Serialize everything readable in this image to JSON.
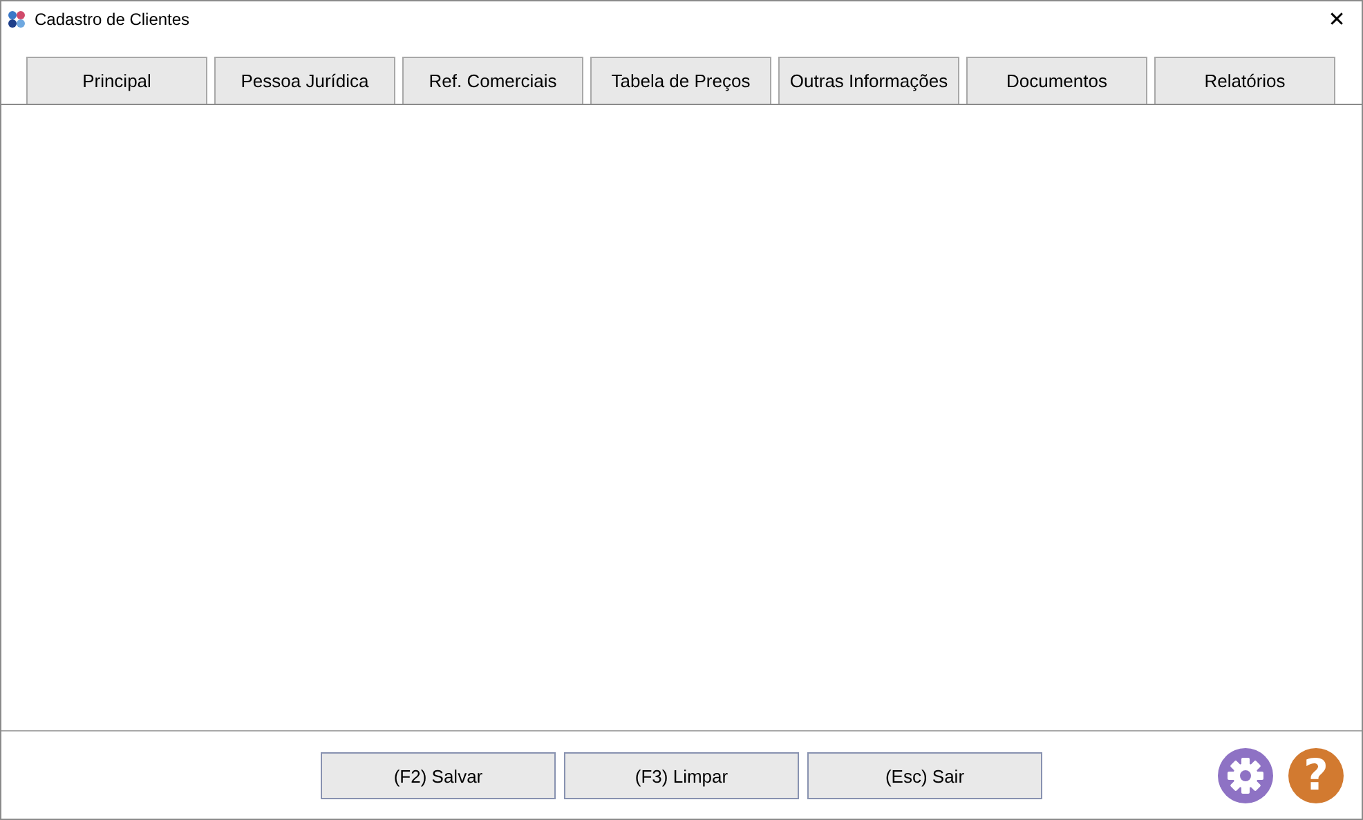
{
  "window": {
    "title": "Cadastro de Clientes",
    "close": "✕"
  },
  "tabs": [
    {
      "label": "Principal",
      "selected": false
    },
    {
      "label": "Pessoa Jurídica",
      "selected": false
    },
    {
      "label": "Ref. Comerciais",
      "selected": false
    },
    {
      "label": "Tabela de Preços",
      "selected": false
    },
    {
      "label": "Outras Informações",
      "selected": false
    },
    {
      "label": "Documentos",
      "selected": false
    },
    {
      "label": "Relatórios",
      "selected": false
    }
  ],
  "buttons": [
    {
      "label": "(F2) Salvar"
    },
    {
      "label": "(F3) Limpar"
    },
    {
      "label": "(Esc) Sair"
    }
  ],
  "help": "?"
}
